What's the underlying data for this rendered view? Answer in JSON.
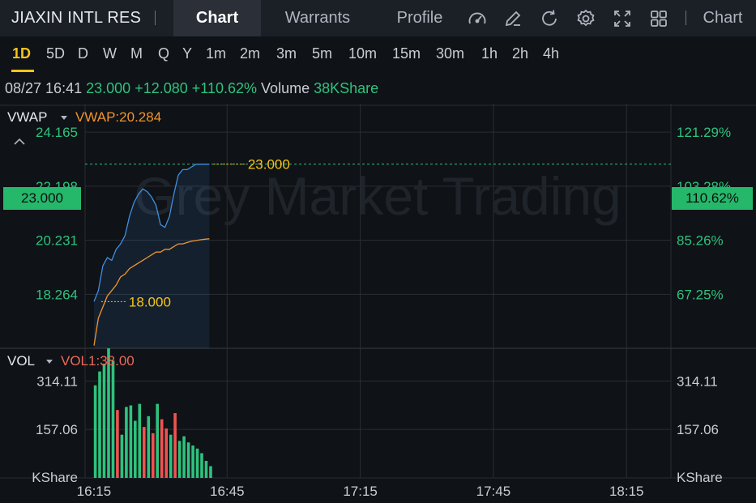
{
  "header": {
    "stock_name": "JIAXIN INTL RES",
    "tabs": [
      "Chart",
      "Warrants",
      "Profile"
    ],
    "active_tab": "Chart",
    "right_label": "Chart",
    "icons": [
      "gauge-icon",
      "draw-icon",
      "refresh-icon",
      "settings-icon",
      "fullscreen-icon",
      "layout-icon"
    ]
  },
  "timeframes": [
    "1D",
    "5D",
    "D",
    "W",
    "M",
    "Q",
    "Y",
    "1m",
    "2m",
    "3m",
    "5m",
    "10m",
    "15m",
    "30m",
    "1h",
    "2h",
    "4h"
  ],
  "active_timeframe": "1D",
  "quote": {
    "datetime": "08/27 16:41",
    "price": "23.000",
    "change": "+12.080",
    "change_pct": "+110.62%",
    "volume_label": "Volume",
    "volume": "38KShare"
  },
  "watermark": "Grey Market Trading",
  "colors": {
    "up": "#2ec27e",
    "down": "#ef5350",
    "price_line": "#3f8fe0",
    "vwap_line": "#f0952e",
    "annotation": "#f5c518",
    "accent": "#f5c518"
  },
  "chart_data": [
    {
      "type": "line",
      "indicator_name": "VWAP",
      "indicator_value": "VWAP:20.284",
      "y_ticks_left": [
        "24.165",
        "22.198",
        "20.231",
        "18.264"
      ],
      "y_ticks_left_values": [
        24.165,
        22.198,
        20.231,
        18.264
      ],
      "y_ticks_right": [
        "121.29%",
        "103.28%",
        "85.26%",
        "67.25%"
      ],
      "last_price_label": "23.000",
      "last_price_pct": "110.62%",
      "ylim": [
        16.3,
        25.2
      ],
      "annotations": [
        {
          "label": "23.000",
          "x": "16:42",
          "y": 23.0
        },
        {
          "label": "18.000",
          "x": "16:17",
          "y": 18.0
        }
      ],
      "series": [
        {
          "kind": "price",
          "x": [
            "16:15",
            "16:16",
            "16:17",
            "16:18",
            "16:19",
            "16:20",
            "16:21",
            "16:22",
            "16:23",
            "16:24",
            "16:25",
            "16:26",
            "16:27",
            "16:28",
            "16:29",
            "16:30",
            "16:31",
            "16:32",
            "16:33",
            "16:34",
            "16:35",
            "16:36",
            "16:37",
            "16:38",
            "16:39",
            "16:40",
            "16:41"
          ],
          "values": [
            18.0,
            18.4,
            19.3,
            19.6,
            19.5,
            19.9,
            20.1,
            20.4,
            21.1,
            21.6,
            21.9,
            22.1,
            22.0,
            21.8,
            21.5,
            20.8,
            20.7,
            21.1,
            21.9,
            22.6,
            22.8,
            22.8,
            22.9,
            23.0,
            23.0,
            23.0,
            23.0
          ]
        },
        {
          "kind": "vwap",
          "x": [
            "16:15",
            "16:16",
            "16:17",
            "16:18",
            "16:19",
            "16:20",
            "16:21",
            "16:22",
            "16:23",
            "16:24",
            "16:25",
            "16:26",
            "16:27",
            "16:28",
            "16:29",
            "16:30",
            "16:31",
            "16:32",
            "16:33",
            "16:34",
            "16:35",
            "16:36",
            "16:37",
            "16:38",
            "16:39",
            "16:40",
            "16:41"
          ],
          "values": [
            16.4,
            17.4,
            17.8,
            18.2,
            18.4,
            18.6,
            18.9,
            19.0,
            19.2,
            19.3,
            19.4,
            19.5,
            19.6,
            19.7,
            19.8,
            19.8,
            19.9,
            19.9,
            20.0,
            20.1,
            20.1,
            20.15,
            20.2,
            20.22,
            20.25,
            20.27,
            20.284
          ]
        }
      ]
    },
    {
      "type": "bar",
      "indicator_name": "VOL",
      "indicator_value": "VOL1:38.00",
      "y_ticks": [
        "314.11",
        "157.06"
      ],
      "y_ticks_values": [
        314.11,
        157.06
      ],
      "y_unit": "KShare",
      "ylim": [
        0,
        420
      ],
      "x_ticks": [
        "16:15",
        "16:45",
        "17:15",
        "17:45",
        "18:15"
      ],
      "x_range": [
        "16:13",
        "18:25"
      ],
      "categories": [
        "16:15",
        "16:16",
        "16:17",
        "16:18",
        "16:19",
        "16:20",
        "16:21",
        "16:22",
        "16:23",
        "16:24",
        "16:25",
        "16:26",
        "16:27",
        "16:28",
        "16:29",
        "16:30",
        "16:31",
        "16:32",
        "16:33",
        "16:34",
        "16:35",
        "16:36",
        "16:37",
        "16:38",
        "16:39",
        "16:40",
        "16:41"
      ],
      "values": [
        300,
        345,
        370,
        420,
        380,
        220,
        140,
        230,
        235,
        185,
        240,
        165,
        200,
        145,
        240,
        190,
        160,
        140,
        210,
        120,
        135,
        115,
        105,
        95,
        80,
        55,
        38
      ],
      "directions": [
        "up",
        "up",
        "up",
        "up",
        "up",
        "down",
        "up",
        "up",
        "up",
        "up",
        "up",
        "down",
        "up",
        "down",
        "up",
        "down",
        "down",
        "up",
        "down",
        "up",
        "up",
        "up",
        "up",
        "up",
        "up",
        "up",
        "up"
      ]
    }
  ]
}
